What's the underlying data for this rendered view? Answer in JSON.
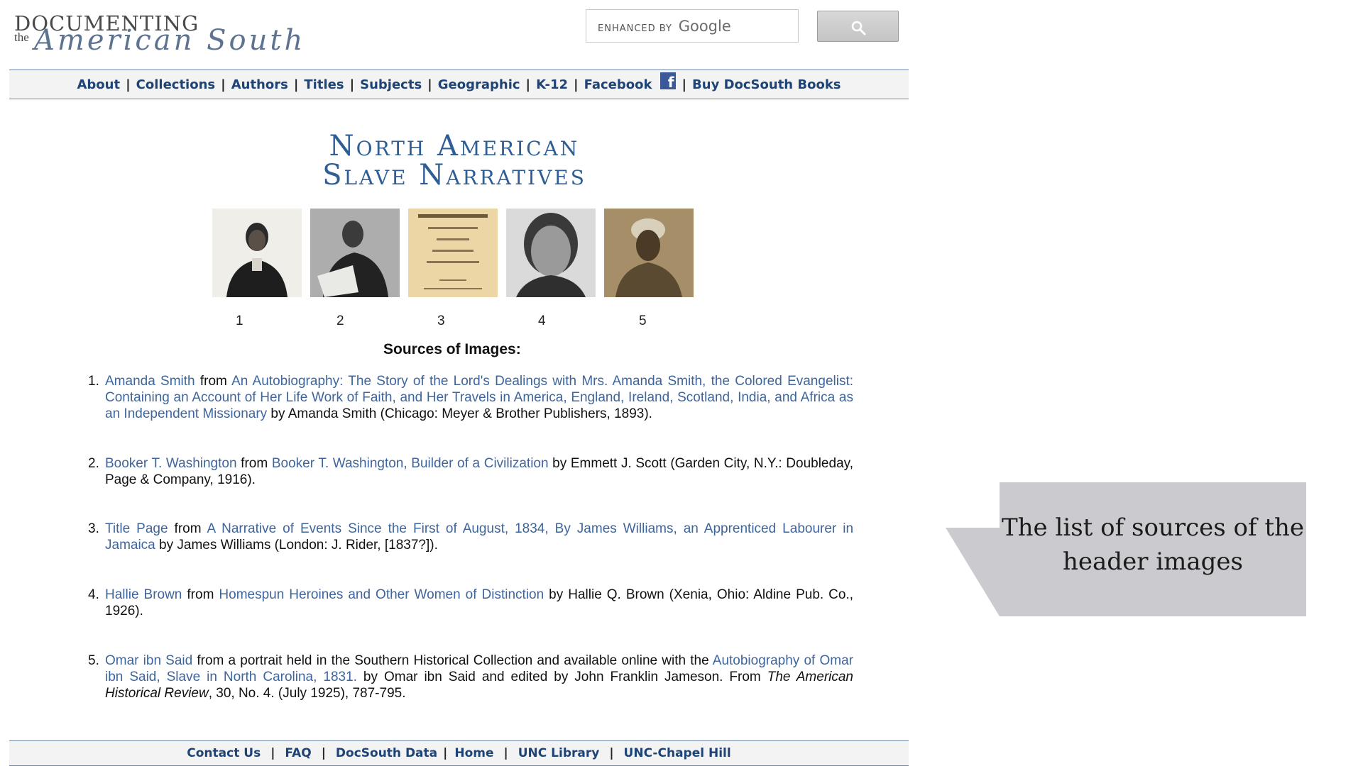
{
  "header": {
    "logo_top": "DOCUMENTING",
    "logo_the": "the",
    "logo_bottom": "American South",
    "search": {
      "enhanced_by": "ENHANCED BY",
      "google": "Google",
      "placeholder": ""
    }
  },
  "nav": {
    "items": [
      "About",
      "Collections",
      "Authors",
      "Titles",
      "Subjects",
      "Geographic",
      "K-12",
      "Facebook",
      "Buy DocSouth Books"
    ],
    "separator": "|"
  },
  "collection": {
    "title_line1": "North American",
    "title_line2": "Slave Narratives"
  },
  "portraits": {
    "numbers": [
      "1",
      "2",
      "3",
      "4",
      "5"
    ]
  },
  "sources": {
    "heading": "Sources of Images:",
    "items": [
      {
        "num": "1.",
        "name": "Amanda Smith",
        "from": " from ",
        "work": "An Autobiography: The Story of the Lord's Dealings with Mrs. Amanda Smith, the Colored Evangelist: Containing an Account of Her Life Work of Faith, and Her Travels in America, England, Ireland, Scotland, India, and Africa as an Independent Missionary",
        "rest": " by Amanda Smith (Chicago: Meyer & Brother Publishers, 1893)."
      },
      {
        "num": "2.",
        "name": "Booker T. Washington",
        "from": " from ",
        "work": "Booker T. Washington, Builder of a Civilization",
        "rest": " by Emmett J. Scott (Garden City, N.Y.: Doubleday, Page & Company, 1916)."
      },
      {
        "num": "3.",
        "name": "Title Page",
        "from": " from ",
        "work": "A Narrative of Events Since the First of August, 1834, By James Williams, an Apprenticed Labourer in Jamaica",
        "rest": " by James Williams (London: J. Rider, [1837?])."
      },
      {
        "num": "4.",
        "name": "Hallie Brown",
        "from": " from ",
        "work": "Homespun Heroines and Other Women of Distinction",
        "rest": " by Hallie Q. Brown (Xenia, Ohio: Aldine Pub. Co., 1926)."
      },
      {
        "num": "5.",
        "name": "Omar ibn Said",
        "from": " from a portrait held in the Southern Historical Collection and available online with the ",
        "work": "Autobiography of Omar ibn Said, Slave in North Carolina, 1831.",
        "rest": " by Omar ibn Said and edited by John Franklin Jameson. From ",
        "italic": "The American Historical Review",
        "tail": ", 30, No. 4. (July 1925), 787-795."
      }
    ]
  },
  "footer": {
    "items": [
      "Contact Us",
      "FAQ",
      "DocSouth Data",
      "Home",
      "UNC Library",
      "UNC-Chapel Hill"
    ],
    "separator": "|"
  },
  "callout": {
    "text": "The list of sources of the header images"
  },
  "colors": {
    "link": "#3e659c",
    "nav": "#1e4375",
    "title": "#2e5e94",
    "callout": "#cbcbcf"
  }
}
